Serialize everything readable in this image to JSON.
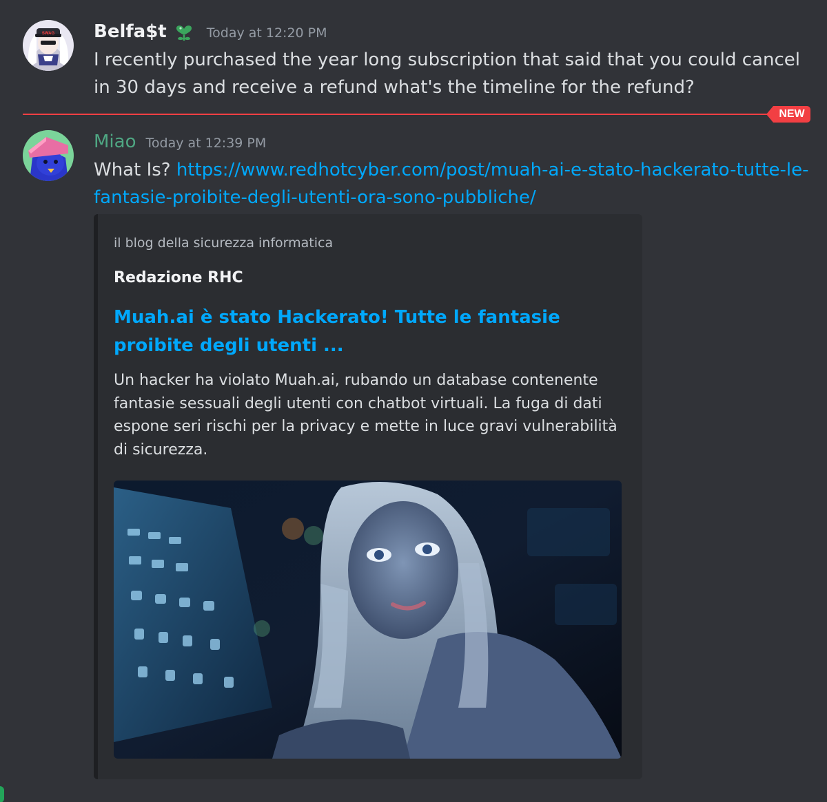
{
  "messages": [
    {
      "username": "Belfa$t",
      "badge_icon": "heart-flower-icon",
      "timestamp": "Today at 12:20 PM",
      "content": "I recently purchased the year long subscription that said that you could cancel in 30 days and receive a refund what's the timeline for the refund?"
    },
    {
      "username": "Miao",
      "timestamp": "Today at 12:39 PM",
      "prefix": "What Is? ",
      "link": "https://www.redhotcyber.com/post/muah-ai-e-stato-hackerato-tutte-le-fantasie-proibite-degli-utenti-ora-sono-pubbliche/"
    }
  ],
  "divider": {
    "label": "NEW",
    "color": "#f23f43"
  },
  "embed": {
    "provider": "il blog della sicurezza informatica",
    "author": "Redazione RHC",
    "title": "Muah.ai è stato Hackerato! Tutte le fantasie proibite degli utenti ...",
    "description": "Un hacker ha violato Muah.ai, rubando un database contenente fantasie sessuali degli utenti con chatbot virtuali. La fuga di dati espone seri rischi per la privacy e mette in luce gravi vulnerabilità di sicurezza."
  },
  "colors": {
    "background": "#313338",
    "link": "#00a8fc",
    "miao_name": "#4fa783"
  }
}
